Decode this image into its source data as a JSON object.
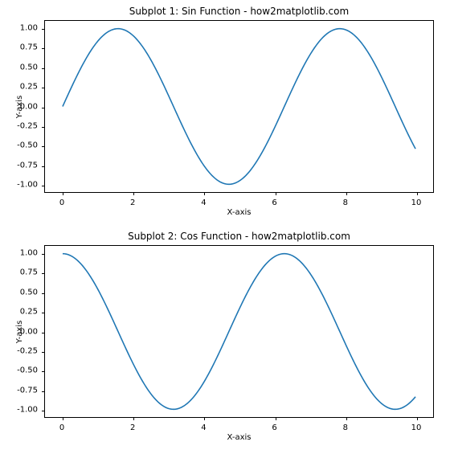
{
  "chart_data": [
    {
      "type": "line",
      "title": "Subplot 1: Sin Function - how2matplotlib.com",
      "xlabel": "X-axis",
      "ylabel": "Y-axis",
      "xlim": [
        -0.5,
        10.5
      ],
      "ylim": [
        -1.1,
        1.1
      ],
      "line_color": "#1f77b4",
      "x": [
        0,
        0.5,
        1,
        1.5,
        2,
        2.5,
        3,
        3.5,
        4,
        4.5,
        5,
        5.5,
        6,
        6.5,
        7,
        7.5,
        8,
        8.5,
        9,
        9.5,
        10
      ],
      "y": [
        0.0,
        0.479,
        0.841,
        0.997,
        0.909,
        0.599,
        0.141,
        -0.351,
        -0.757,
        -0.978,
        -0.959,
        -0.706,
        -0.279,
        0.215,
        0.657,
        0.938,
        0.989,
        0.798,
        0.412,
        -0.075,
        -0.544
      ],
      "x_ticks": [
        0,
        2,
        4,
        6,
        8,
        10
      ],
      "x_tick_labels": [
        "0",
        "2",
        "4",
        "6",
        "8",
        "10"
      ],
      "y_ticks": [
        -1.0,
        -0.75,
        -0.5,
        -0.25,
        0.0,
        0.25,
        0.5,
        0.75,
        1.0
      ],
      "y_tick_labels": [
        "-1.00",
        "-0.75",
        "-0.50",
        "-0.25",
        "0.00",
        "0.25",
        "0.50",
        "0.75",
        "1.00"
      ]
    },
    {
      "type": "line",
      "title": "Subplot 2: Cos Function - how2matplotlib.com",
      "xlabel": "X-axis",
      "ylabel": "Y-axis",
      "xlim": [
        -0.5,
        10.5
      ],
      "ylim": [
        -1.1,
        1.1
      ],
      "line_color": "#1f77b4",
      "x": [
        0,
        0.5,
        1,
        1.5,
        2,
        2.5,
        3,
        3.5,
        4,
        4.5,
        5,
        5.5,
        6,
        6.5,
        7,
        7.5,
        8,
        8.5,
        9,
        9.5,
        10
      ],
      "y": [
        1.0,
        0.878,
        0.54,
        0.071,
        -0.416,
        -0.801,
        -0.99,
        -0.936,
        -0.654,
        -0.211,
        0.284,
        0.709,
        0.96,
        0.977,
        0.754,
        0.347,
        -0.146,
        -0.602,
        -0.911,
        -0.997,
        -0.839
      ],
      "x_ticks": [
        0,
        2,
        4,
        6,
        8,
        10
      ],
      "x_tick_labels": [
        "0",
        "2",
        "4",
        "6",
        "8",
        "10"
      ],
      "y_ticks": [
        -1.0,
        -0.75,
        -0.5,
        -0.25,
        0.0,
        0.25,
        0.5,
        0.75,
        1.0
      ],
      "y_tick_labels": [
        "-1.00",
        "-0.75",
        "-0.50",
        "-0.25",
        "0.00",
        "0.25",
        "0.50",
        "0.75",
        "1.00"
      ]
    }
  ]
}
